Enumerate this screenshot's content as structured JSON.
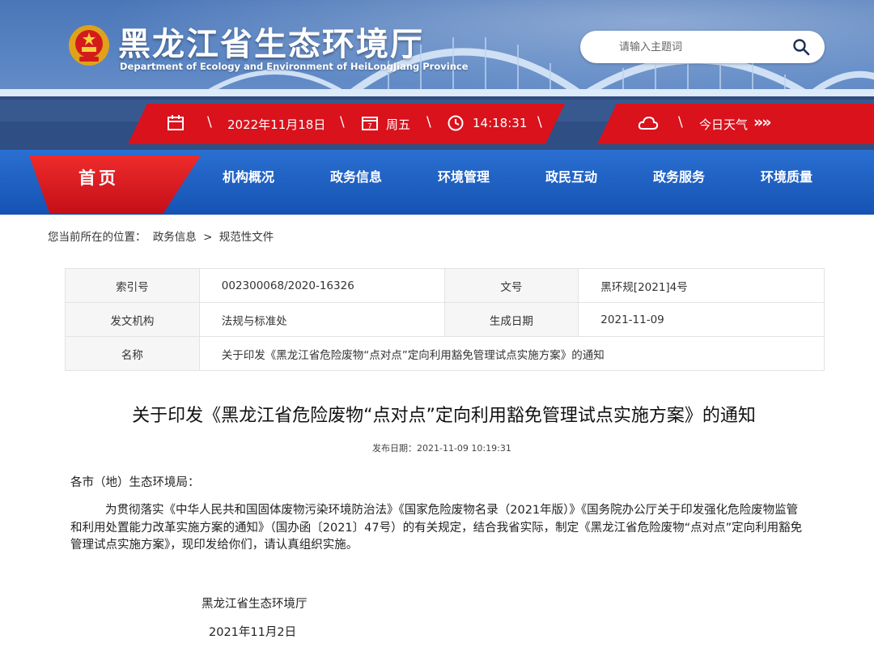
{
  "header": {
    "site_title": "黑龙江省生态环境厅",
    "site_subtitle": "Department of Ecology and Environment of HeiLongJiang Province",
    "search_placeholder": "请输入主题词",
    "date": "2022年11月18日",
    "weekday": "周五",
    "time": "14:18:31",
    "weather_label": "今日天气",
    "weather_arrows": "»»",
    "separator": "\\"
  },
  "nav": {
    "home": "首页",
    "items": [
      "机构概况",
      "政务信息",
      "环境管理",
      "政民互动",
      "政务服务",
      "环境质量"
    ]
  },
  "breadcrumb": {
    "prefix": "您当前所在的位置：",
    "items": [
      "政务信息",
      "规范性文件"
    ],
    "separator": ">"
  },
  "meta": {
    "index_label": "索引号",
    "index_value": "002300068/2020-16326",
    "doc_no_label": "文号",
    "doc_no_value": "黑环规[2021]4号",
    "issuer_label": "发文机构",
    "issuer_value": "法规与标准处",
    "date_label": "生成日期",
    "date_value": "2021-11-09",
    "name_label": "名称",
    "name_value": "关于印发《黑龙江省危险废物“点对点”定向利用豁免管理试点实施方案》的通知"
  },
  "article": {
    "title": "关于印发《黑龙江省危险废物“点对点”定向利用豁免管理试点实施方案》的通知",
    "publish_date": "发布日期：2021-11-09 10:19:31",
    "salutation": "各市（地）生态环境局：",
    "body": "为贯彻落实《中华人民共和国固体废物污染环境防治法》《国家危险废物名录（2021年版）》《国务院办公厅关于印发强化危险废物监管和利用处置能力改革实施方案的通知》（国办函〔2021〕47号）的有关规定，结合我省实际，制定《黑龙江省危险废物“点对点”定向利用豁免管理试点实施方案》，现印发给你们，请认真组织实施。",
    "signature": "黑龙江省生态环境厅",
    "sign_date": "2021年11月2日"
  },
  "colors": {
    "accent_red": "#d9121c",
    "nav_blue": "#1553b3"
  }
}
